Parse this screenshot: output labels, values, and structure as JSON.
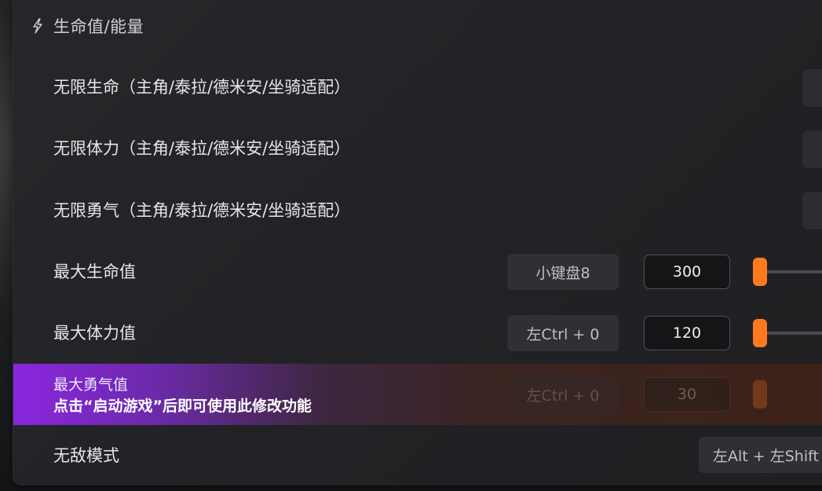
{
  "section": {
    "title": "生命值/能量",
    "icon": "lightning-icon"
  },
  "rows": [
    {
      "label": "无限生命（主角/泰拉/德米安/坐骑适配）"
    },
    {
      "label": "无限体力（主角/泰拉/德米安/坐骑适配）"
    },
    {
      "label": "无限勇气（主角/泰拉/德米安/坐骑适配）"
    },
    {
      "label": "最大生命值",
      "hotkey": "小键盘8",
      "value": "300"
    },
    {
      "label": "最大体力值",
      "hotkey": "左Ctrl + 0",
      "value": "120"
    },
    {
      "label": "最大勇气值",
      "hotkey": "左Ctrl + 0",
      "value": "30"
    },
    {
      "label": "无敌模式",
      "hotkey": "左Alt + 左Shift"
    }
  ],
  "banner": {
    "message": "点击“启动游戏”后即可使用此修改功能"
  },
  "colors": {
    "accent": "#ff7a1f",
    "banner_start": "#8a26de",
    "panel": "#222326"
  }
}
